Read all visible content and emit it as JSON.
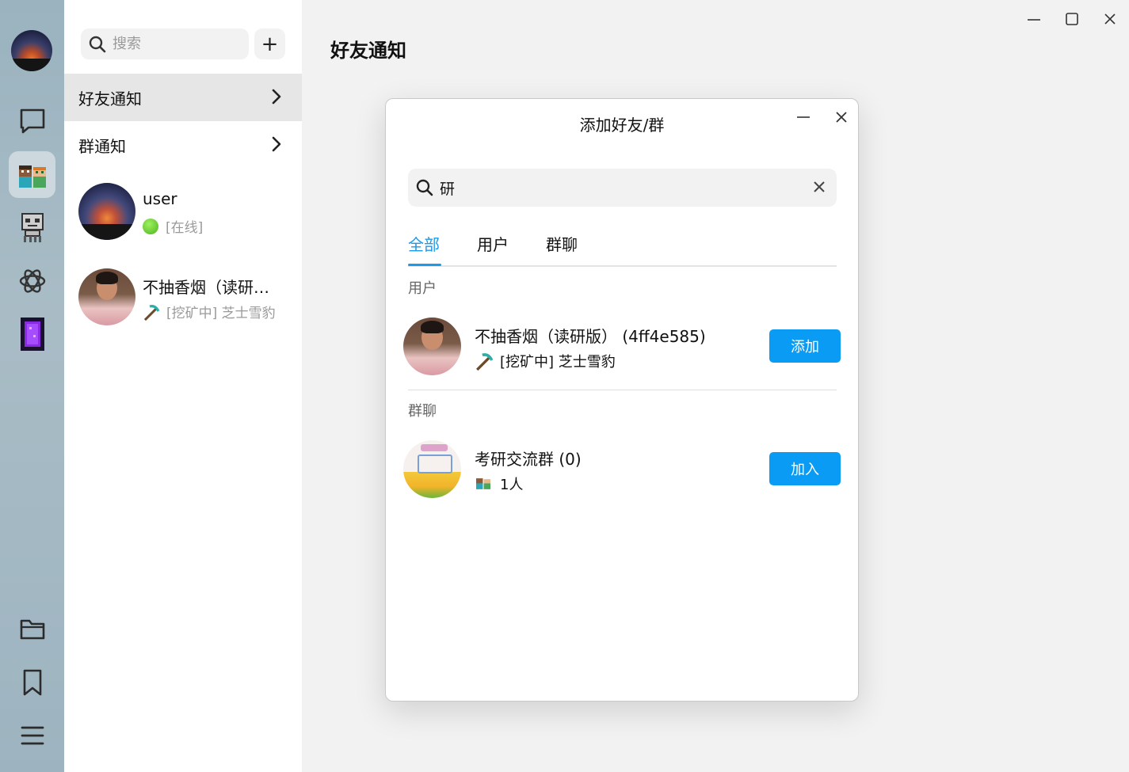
{
  "sidebar_rail": {
    "items": [
      {
        "icon": "chat-bubble-icon"
      },
      {
        "icon": "friends-icon",
        "active": true
      },
      {
        "icon": "robot-icon"
      },
      {
        "icon": "openai-icon"
      },
      {
        "icon": "portal-icon"
      }
    ],
    "bottom": [
      {
        "icon": "folder-icon"
      },
      {
        "icon": "bookmark-icon"
      },
      {
        "icon": "menu-icon"
      }
    ]
  },
  "list": {
    "search_placeholder": "搜索",
    "add_label": "+",
    "nav": [
      {
        "label": "好友通知",
        "active": true
      },
      {
        "label": "群通知"
      }
    ],
    "contacts": [
      {
        "name": "user",
        "status": "[在线]",
        "status_icon": "online-dot-icon"
      },
      {
        "name": "不抽香烟（读研…",
        "status": "[挖矿中] 芝士雪豹",
        "status_icon": "pickaxe-icon"
      }
    ]
  },
  "main": {
    "title": "好友通知"
  },
  "dialog": {
    "title": "添加好友/群",
    "search_value": "研",
    "tabs": [
      "全部",
      "用户",
      "群聊"
    ],
    "active_tab": "全部",
    "sections": {
      "users_label": "用户",
      "groups_label": "群聊"
    },
    "user_result": {
      "name": "不抽香烟（读研版） (4ff4e585)",
      "status": "[挖矿中] 芝士雪豹",
      "button": "添加"
    },
    "group_result": {
      "name": "考研交流群 (0)",
      "members": "1人",
      "button": "加入"
    }
  },
  "colors": {
    "accent": "#0a9cf5",
    "tab_active": "#1a9ae8",
    "rail_bg": "#a3b9c4"
  }
}
